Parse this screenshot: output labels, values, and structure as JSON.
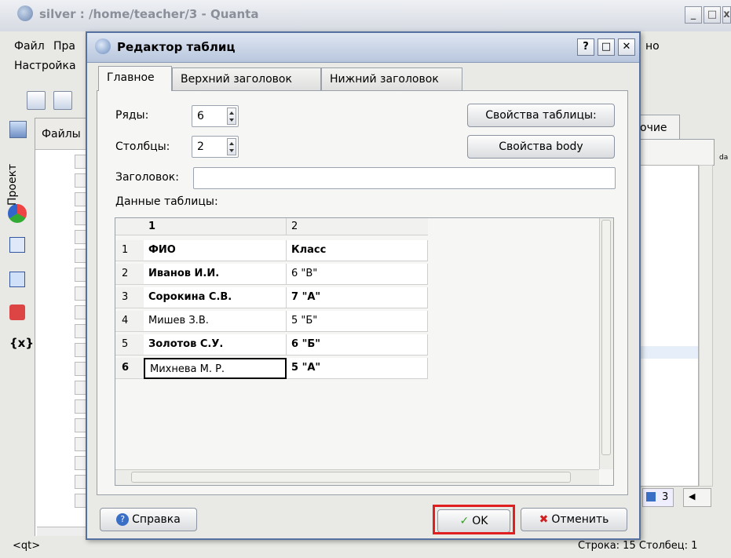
{
  "app": {
    "title": "silver : /home/teacher/3 - Quanta",
    "menu": [
      "Файл",
      "Пра",
      "Настройка"
    ],
    "right_tab": "очие",
    "right_tab_small": "da",
    "side_tab_project": "Проект",
    "files_tab": "Файлы",
    "pager": "3"
  },
  "status": {
    "left": "<qt>",
    "right": "Строка: 15 Столбец: 1",
    "menu_right": "но"
  },
  "dialog": {
    "title": "Редактор таблиц",
    "title_buttons": [
      "?",
      "□",
      "✕"
    ],
    "tabs": [
      "Главное",
      "Верхний заголовок",
      "Нижний заголовок"
    ],
    "rows_label": "Ряды:",
    "rows_value": "6",
    "cols_label": "Столбцы:",
    "cols_value": "2",
    "caption_label": "Заголовок:",
    "caption_value": "",
    "table_props_button": "Свойства таблицы:",
    "body_props_button": "Свойства body",
    "data_label": "Данные таблицы:",
    "grid": {
      "columns": [
        "1",
        "2"
      ],
      "rows": [
        {
          "n": "1",
          "c1": "ФИО",
          "c2": "Класс"
        },
        {
          "n": "2",
          "c1": "Иванов И.И.",
          "c2": "6 \"В\""
        },
        {
          "n": "3",
          "c1": "Сорокина С.В.",
          "c2": "7 \"А\""
        },
        {
          "n": "4",
          "c1": "Мишев З.В.",
          "c2": "5 \"Б\""
        },
        {
          "n": "5",
          "c1": "Золотов С.У.",
          "c2": "6 \"Б\""
        },
        {
          "n": "6",
          "c1": "Михнева М. Р.",
          "c2": "5 \"А\""
        }
      ]
    },
    "help_button": "Справка",
    "ok_button": "OK",
    "cancel_button": "Отменить"
  }
}
